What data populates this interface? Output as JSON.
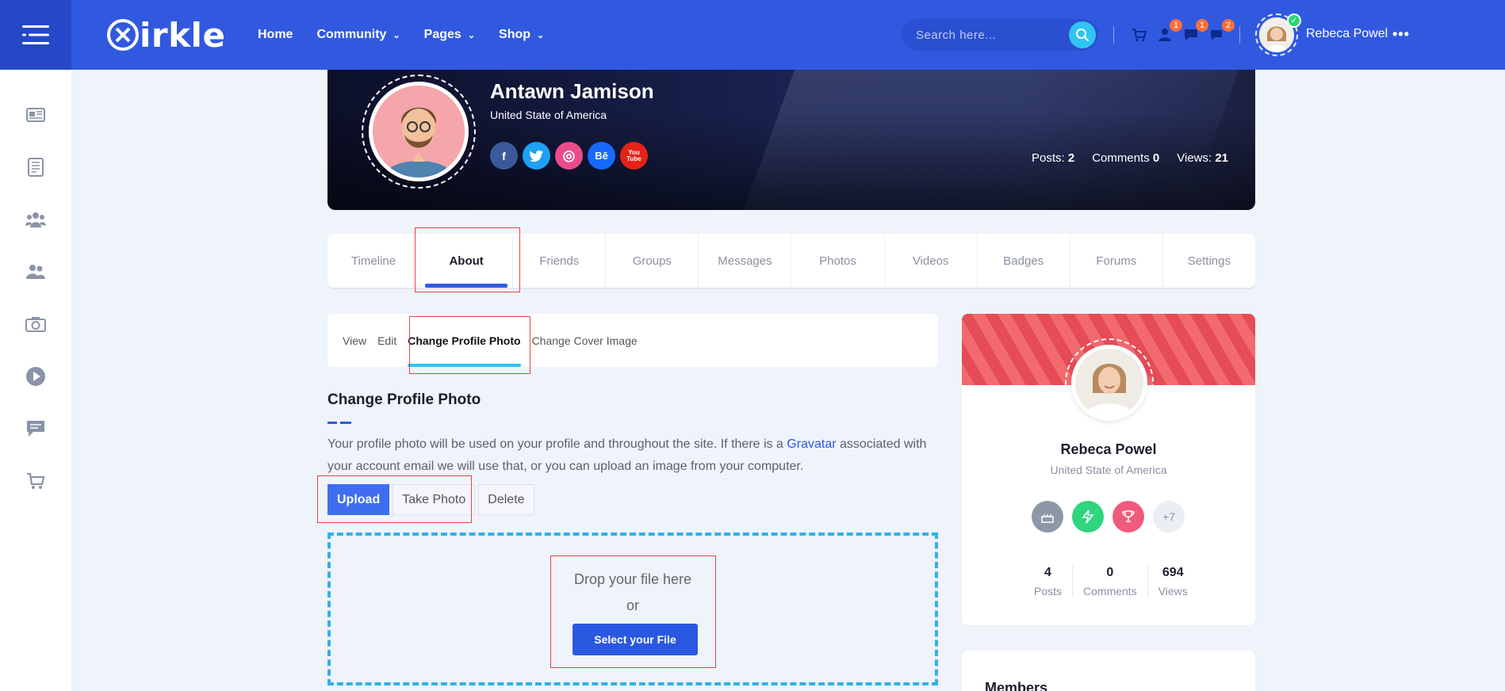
{
  "brand": {
    "logo_text": "irkle"
  },
  "nav": [
    {
      "label": "Home",
      "has_dropdown": false
    },
    {
      "label": "Community",
      "has_dropdown": true
    },
    {
      "label": "Pages",
      "has_dropdown": true
    },
    {
      "label": "Shop",
      "has_dropdown": true
    }
  ],
  "search": {
    "placeholder": "Search here..."
  },
  "header_badges": {
    "friends": "1",
    "messages": "1",
    "notifications": "2"
  },
  "current_user": {
    "name": "Rebeca Powel",
    "more": "•••"
  },
  "profile": {
    "name": "Antawn Jamison",
    "location": "United State of America",
    "socials": [
      {
        "icon": "facebook-icon",
        "label": "f",
        "color": "#3b5998"
      },
      {
        "icon": "twitter-icon",
        "label": "t",
        "color": "#1da1f2"
      },
      {
        "icon": "dribbble-icon",
        "label": "◎",
        "color": "#ea4c89"
      },
      {
        "icon": "behance-icon",
        "label": "Bē",
        "color": "#1769ff"
      },
      {
        "icon": "youtube-icon",
        "label": "You Tube",
        "color": "#e62117"
      }
    ],
    "stats": {
      "posts_label": "Posts:",
      "posts": "2",
      "comments_label": "Comments",
      "comments": "0",
      "views_label": "Views:",
      "views": "21"
    }
  },
  "tabs": [
    "Timeline",
    "About",
    "Friends",
    "Groups",
    "Messages",
    "Photos",
    "Videos",
    "Badges",
    "Forums",
    "Settings"
  ],
  "active_tab": "About",
  "subtabs": [
    "View",
    "Edit",
    "Change Profile Photo",
    "Change Cover Image"
  ],
  "active_subtab": "Change Profile Photo",
  "section": {
    "title": "Change Profile Photo",
    "desc_part1": "Your profile photo will be used on your profile and throughout the site. If there is a ",
    "desc_link": "Gravatar",
    "desc_part2": " associated with your account email we will use that, or you can upload an image from your computer."
  },
  "buttons": {
    "upload": "Upload",
    "take_photo": "Take Photo",
    "delete": "Delete"
  },
  "dropzone": {
    "text": "Drop your file here",
    "or": "or",
    "select": "Select your File"
  },
  "user_card": {
    "name": "Rebeca Powel",
    "location": "United State of America",
    "badges": [
      {
        "icon": "cake-icon",
        "color": "#8e97a8"
      },
      {
        "icon": "lightning-icon",
        "color": "#2fd57f"
      },
      {
        "icon": "trophy-icon",
        "color": "#f15b7b"
      }
    ],
    "badges_more": "+7",
    "stats": [
      {
        "value": "4",
        "label": "Posts"
      },
      {
        "value": "0",
        "label": "Comments"
      },
      {
        "value": "694",
        "label": "Views"
      }
    ]
  },
  "members_card": {
    "title": "Members"
  },
  "colors": {
    "primary": "#3159e0",
    "accent": "#2ec5f2",
    "highlight": "#e0454a"
  }
}
